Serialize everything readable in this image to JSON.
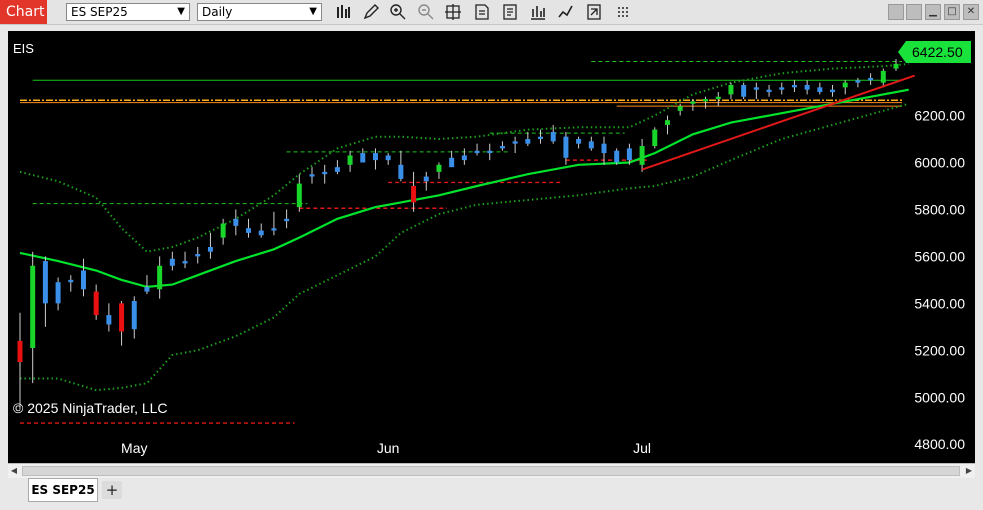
{
  "toolbar": {
    "chart_label": "Chart",
    "instrument": "ES SEP25",
    "interval": "Daily",
    "icons": [
      "bar-style-icon",
      "draw-pencil-icon",
      "zoom-in-icon",
      "zoom-out-icon",
      "crosshair-icon",
      "properties-icon",
      "strategies-icon",
      "indicators-icon",
      "templates-icon",
      "share-icon",
      "more-icon"
    ]
  },
  "chart": {
    "instrument_label": "EIS",
    "copyright": "© 2025 NinjaTrader, LLC",
    "last_price": "6422.50",
    "colors": {
      "background": "#000000",
      "up": "#19d62a",
      "down": "#e81010",
      "blue": "#3a8fe8",
      "sma": "#00e32c",
      "bollinger": "#1e9e1e",
      "trend": "#e01818",
      "orange": "#ff9a1a",
      "price_tag": "#19e23a"
    }
  },
  "chart_data": {
    "type": "candlestick",
    "y_ticks": [
      "6200.00",
      "6000.00",
      "5800.00",
      "5600.00",
      "5400.00",
      "5200.00",
      "5000.00",
      "4800.00"
    ],
    "ylim": [
      4720,
      6560
    ],
    "x_labels": [
      {
        "label": "May",
        "index": 9
      },
      {
        "label": "Jun",
        "index": 29
      },
      {
        "label": "Jul",
        "index": 49
      }
    ],
    "candles": [
      [
        5150,
        5360,
        4950,
        5240,
        "r"
      ],
      [
        5210,
        5620,
        5060,
        5560,
        "g"
      ],
      [
        5580,
        5600,
        5300,
        5400,
        "b"
      ],
      [
        5400,
        5510,
        5370,
        5490,
        "b"
      ],
      [
        5500,
        5520,
        5450,
        5490,
        "b"
      ],
      [
        5540,
        5590,
        5430,
        5460,
        "b"
      ],
      [
        5450,
        5480,
        5330,
        5350,
        "r"
      ],
      [
        5310,
        5400,
        5280,
        5350,
        "b"
      ],
      [
        5400,
        5410,
        5220,
        5280,
        "r"
      ],
      [
        5410,
        5430,
        5250,
        5290,
        "b"
      ],
      [
        5470,
        5520,
        5440,
        5450,
        "b"
      ],
      [
        5460,
        5600,
        5420,
        5560,
        "g"
      ],
      [
        5590,
        5620,
        5540,
        5560,
        "b"
      ],
      [
        5570,
        5620,
        5550,
        5580,
        "b"
      ],
      [
        5600,
        5640,
        5570,
        5610,
        "b"
      ],
      [
        5620,
        5700,
        5590,
        5640,
        "b"
      ],
      [
        5680,
        5760,
        5650,
        5740,
        "g"
      ],
      [
        5760,
        5800,
        5690,
        5730,
        "b"
      ],
      [
        5720,
        5760,
        5680,
        5700,
        "b"
      ],
      [
        5710,
        5740,
        5680,
        5690,
        "b"
      ],
      [
        5710,
        5790,
        5690,
        5720,
        "b"
      ],
      [
        5760,
        5800,
        5720,
        5750,
        "b"
      ],
      [
        5810,
        5950,
        5790,
        5910,
        "g"
      ],
      [
        5950,
        5980,
        5910,
        5940,
        "b"
      ],
      [
        5960,
        5990,
        5910,
        5950,
        "b"
      ],
      [
        5980,
        6010,
        5950,
        5960,
        "b"
      ],
      [
        5990,
        6050,
        5960,
        6030,
        "g"
      ],
      [
        6040,
        6060,
        6020,
        6000,
        "b"
      ],
      [
        6040,
        6060,
        5970,
        6010,
        "b"
      ],
      [
        6010,
        6040,
        5990,
        6030,
        "b"
      ],
      [
        5990,
        6050,
        5920,
        5930,
        "b"
      ],
      [
        5900,
        5960,
        5790,
        5830,
        "r"
      ],
      [
        5920,
        5960,
        5880,
        5940,
        "b"
      ],
      [
        5960,
        6000,
        5930,
        5990,
        "g"
      ],
      [
        6020,
        6050,
        5990,
        5980,
        "b"
      ],
      [
        6010,
        6060,
        5990,
        6030,
        "b"
      ],
      [
        6050,
        6080,
        6030,
        6040,
        "b"
      ],
      [
        6040,
        6080,
        6010,
        6050,
        "b"
      ],
      [
        6070,
        6090,
        6050,
        6060,
        "b"
      ],
      [
        6080,
        6110,
        6040,
        6090,
        "b"
      ],
      [
        6100,
        6130,
        6070,
        6080,
        "b"
      ],
      [
        6110,
        6140,
        6080,
        6100,
        "b"
      ],
      [
        6130,
        6160,
        6080,
        6090,
        "b"
      ],
      [
        6110,
        6130,
        5990,
        6020,
        "b"
      ],
      [
        6100,
        6110,
        6060,
        6080,
        "b"
      ],
      [
        6090,
        6110,
        6050,
        6060,
        "b"
      ],
      [
        6080,
        6110,
        5990,
        6040,
        "b"
      ],
      [
        6050,
        6060,
        5990,
        6000,
        "b"
      ],
      [
        6060,
        6080,
        5990,
        6010,
        "b"
      ],
      [
        5990,
        6100,
        5960,
        6070,
        "g"
      ],
      [
        6070,
        6150,
        6060,
        6140,
        "g"
      ],
      [
        6160,
        6200,
        6120,
        6180,
        "g"
      ],
      [
        6220,
        6250,
        6200,
        6240,
        "g"
      ],
      [
        6250,
        6270,
        6220,
        6260,
        "g"
      ],
      [
        6260,
        6280,
        6230,
        6270,
        "g"
      ],
      [
        6270,
        6300,
        6240,
        6280,
        "g"
      ],
      [
        6290,
        6340,
        6270,
        6330,
        "g"
      ],
      [
        6330,
        6340,
        6270,
        6280,
        "b"
      ],
      [
        6310,
        6340,
        6270,
        6320,
        "b"
      ],
      [
        6310,
        6330,
        6280,
        6300,
        "b"
      ],
      [
        6320,
        6340,
        6290,
        6310,
        "b"
      ],
      [
        6330,
        6350,
        6300,
        6320,
        "b"
      ],
      [
        6330,
        6350,
        6290,
        6310,
        "b"
      ],
      [
        6320,
        6340,
        6290,
        6300,
        "b"
      ],
      [
        6310,
        6330,
        6280,
        6300,
        "b"
      ],
      [
        6320,
        6350,
        6290,
        6340,
        "g"
      ],
      [
        6340,
        6360,
        6320,
        6350,
        "b"
      ],
      [
        6350,
        6380,
        6330,
        6360,
        "b"
      ],
      [
        6340,
        6400,
        6320,
        6390,
        "g"
      ],
      [
        6400,
        6440,
        6390,
        6420,
        "g"
      ]
    ],
    "sma": [
      [
        0,
        5615
      ],
      [
        3,
        5580
      ],
      [
        6,
        5540
      ],
      [
        8,
        5500
      ],
      [
        10,
        5470
      ],
      [
        12,
        5480
      ],
      [
        14,
        5520
      ],
      [
        17,
        5580
      ],
      [
        20,
        5630
      ],
      [
        22,
        5680
      ],
      [
        25,
        5760
      ],
      [
        28,
        5810
      ],
      [
        30,
        5830
      ],
      [
        33,
        5860
      ],
      [
        36,
        5900
      ],
      [
        40,
        5950
      ],
      [
        44,
        5990
      ],
      [
        48,
        6000
      ],
      [
        50,
        6040
      ],
      [
        53,
        6120
      ],
      [
        56,
        6170
      ],
      [
        60,
        6210
      ],
      [
        64,
        6250
      ],
      [
        68,
        6290
      ],
      [
        70,
        6310
      ]
    ],
    "bollinger_upper": [
      [
        0,
        5960
      ],
      [
        3,
        5920
      ],
      [
        6,
        5850
      ],
      [
        8,
        5720
      ],
      [
        10,
        5620
      ],
      [
        12,
        5640
      ],
      [
        14,
        5680
      ],
      [
        17,
        5760
      ],
      [
        20,
        5860
      ],
      [
        22,
        5950
      ],
      [
        25,
        6060
      ],
      [
        28,
        6110
      ],
      [
        30,
        6110
      ],
      [
        33,
        6100
      ],
      [
        36,
        6110
      ],
      [
        40,
        6140
      ],
      [
        44,
        6150
      ],
      [
        48,
        6150
      ],
      [
        50,
        6200
      ],
      [
        53,
        6290
      ],
      [
        56,
        6340
      ],
      [
        60,
        6380
      ],
      [
        64,
        6400
      ],
      [
        68,
        6410
      ],
      [
        70,
        6420
      ]
    ],
    "bollinger_lower": [
      [
        0,
        5080
      ],
      [
        3,
        5080
      ],
      [
        6,
        5030
      ],
      [
        8,
        5040
      ],
      [
        10,
        5060
      ],
      [
        12,
        5180
      ],
      [
        14,
        5200
      ],
      [
        17,
        5260
      ],
      [
        20,
        5340
      ],
      [
        22,
        5440
      ],
      [
        25,
        5520
      ],
      [
        28,
        5600
      ],
      [
        30,
        5700
      ],
      [
        33,
        5780
      ],
      [
        36,
        5820
      ],
      [
        40,
        5840
      ],
      [
        44,
        5860
      ],
      [
        48,
        5890
      ],
      [
        50,
        5900
      ],
      [
        53,
        5940
      ],
      [
        56,
        6010
      ],
      [
        60,
        6100
      ],
      [
        64,
        6160
      ],
      [
        68,
        6220
      ],
      [
        70,
        6250
      ]
    ],
    "trend_line": [
      [
        49,
        5970
      ],
      [
        70,
        6370
      ]
    ],
    "levels": [
      {
        "y": 6350,
        "x0": 1,
        "x1": 70,
        "style": "solid-green"
      },
      {
        "y": 6265,
        "x0": 0,
        "x1": 70,
        "style": "orange-dashdot"
      },
      {
        "y": 6255,
        "x0": 0,
        "x1": 70,
        "style": "orange-solid"
      },
      {
        "y": 6240,
        "x0": 47,
        "x1": 70,
        "style": "orange-solid"
      },
      {
        "y": 6430,
        "x0": 45,
        "x1": 70,
        "style": "green-dash"
      },
      {
        "y": 6045,
        "x0": 21,
        "x1": 38,
        "style": "green-dash"
      },
      {
        "y": 6125,
        "x0": 37,
        "x1": 47,
        "style": "green-dash"
      },
      {
        "y": 5825,
        "x0": 1,
        "x1": 22,
        "style": "green-dash"
      },
      {
        "y": 5805,
        "x0": 22,
        "x1": 33,
        "style": "red-dash"
      },
      {
        "y": 5915,
        "x0": 29,
        "x1": 42,
        "style": "red-dash"
      },
      {
        "y": 6010,
        "x0": 43,
        "x1": 49,
        "style": "red-dash"
      },
      {
        "y": 4890,
        "x0": 0,
        "x1": 21,
        "style": "red-dash"
      }
    ]
  },
  "tabs": {
    "active": "ES SEP25",
    "add_label": "+"
  }
}
